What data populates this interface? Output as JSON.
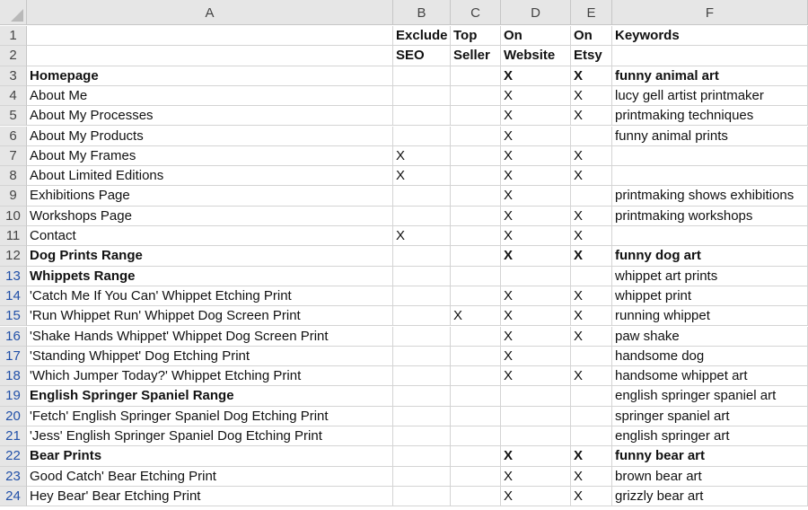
{
  "columns": [
    "A",
    "B",
    "C",
    "D",
    "E",
    "F"
  ],
  "rows": [
    {
      "num": "1",
      "blue": false,
      "bold": false,
      "cells": [
        "",
        "Exclude",
        "Top",
        "On",
        "On",
        "Keywords"
      ],
      "boldCols": [
        1,
        2,
        3,
        4,
        5
      ]
    },
    {
      "num": "2",
      "blue": false,
      "bold": false,
      "cells": [
        "",
        "SEO",
        "Seller",
        "Website",
        "Etsy",
        ""
      ],
      "boldCols": [
        1,
        2,
        3,
        4,
        5
      ]
    },
    {
      "num": "3",
      "blue": false,
      "bold": true,
      "cells": [
        "Homepage",
        "",
        "",
        "X",
        "X",
        "funny animal art"
      ]
    },
    {
      "num": "4",
      "blue": false,
      "bold": false,
      "cells": [
        "About Me",
        "",
        "",
        "X",
        "X",
        "lucy gell artist printmaker"
      ]
    },
    {
      "num": "5",
      "blue": false,
      "bold": false,
      "cells": [
        "About My Processes",
        "",
        "",
        "X",
        "X",
        "printmaking techniques"
      ]
    },
    {
      "num": "6",
      "blue": false,
      "bold": false,
      "cells": [
        "About My Products",
        "",
        "",
        "X",
        "",
        "funny animal prints"
      ]
    },
    {
      "num": "7",
      "blue": false,
      "bold": false,
      "cells": [
        "About My Frames",
        "X",
        "",
        "X",
        "X",
        ""
      ]
    },
    {
      "num": "8",
      "blue": false,
      "bold": false,
      "cells": [
        "About Limited Editions",
        "X",
        "",
        "X",
        "X",
        ""
      ]
    },
    {
      "num": "9",
      "blue": false,
      "bold": false,
      "cells": [
        "Exhibitions Page",
        "",
        "",
        "X",
        "",
        "printmaking shows exhibitions"
      ]
    },
    {
      "num": "10",
      "blue": false,
      "bold": false,
      "cells": [
        "Workshops Page",
        "",
        "",
        "X",
        "X",
        "printmaking workshops"
      ]
    },
    {
      "num": "11",
      "blue": false,
      "bold": false,
      "cells": [
        "Contact",
        "X",
        "",
        "X",
        "X",
        ""
      ]
    },
    {
      "num": "12",
      "blue": false,
      "bold": true,
      "cells": [
        "Dog Prints Range",
        "",
        "",
        "X",
        "X",
        "funny dog art"
      ]
    },
    {
      "num": "13",
      "blue": true,
      "bold": true,
      "cells": [
        "Whippets Range",
        "",
        "",
        "",
        "",
        "whippet art prints"
      ],
      "boldCols": [
        0
      ]
    },
    {
      "num": "14",
      "blue": true,
      "bold": false,
      "cells": [
        "'Catch Me If You Can' Whippet Etching Print",
        "",
        "",
        "X",
        "X",
        "whippet print"
      ]
    },
    {
      "num": "15",
      "blue": true,
      "bold": false,
      "cells": [
        "'Run Whippet Run' Whippet Dog Screen Print",
        "",
        "X",
        "X",
        "X",
        "running whippet"
      ]
    },
    {
      "num": "16",
      "blue": true,
      "bold": false,
      "cells": [
        "'Shake Hands Whippet' Whippet Dog Screen Print",
        "",
        "",
        "X",
        "X",
        "paw shake"
      ]
    },
    {
      "num": "17",
      "blue": true,
      "bold": false,
      "cells": [
        "'Standing Whippet' Dog Etching Print",
        "",
        "",
        "X",
        "",
        "handsome dog"
      ]
    },
    {
      "num": "18",
      "blue": true,
      "bold": false,
      "cells": [
        "'Which Jumper Today?' Whippet Etching Print",
        "",
        "",
        "X",
        "X",
        "handsome whippet art"
      ]
    },
    {
      "num": "19",
      "blue": true,
      "bold": true,
      "cells": [
        "English Springer Spaniel Range",
        "",
        "",
        "",
        "",
        "english springer spaniel art"
      ],
      "boldCols": [
        0
      ]
    },
    {
      "num": "20",
      "blue": true,
      "bold": false,
      "cells": [
        "'Fetch' English Springer Spaniel Dog Etching Print",
        "",
        "",
        "",
        "",
        "springer spaniel art"
      ]
    },
    {
      "num": "21",
      "blue": true,
      "bold": false,
      "cells": [
        "'Jess' English Springer Spaniel Dog Etching Print",
        "",
        "",
        "",
        "",
        "english springer art"
      ]
    },
    {
      "num": "22",
      "blue": true,
      "bold": true,
      "cells": [
        "Bear Prints",
        "",
        "",
        "X",
        "X",
        "funny bear art"
      ]
    },
    {
      "num": "23",
      "blue": true,
      "bold": false,
      "cells": [
        "Good Catch' Bear Etching Print",
        "",
        "",
        "X",
        "X",
        "brown bear art"
      ]
    },
    {
      "num": "24",
      "blue": true,
      "bold": false,
      "cells": [
        "Hey Bear' Bear Etching Print",
        "",
        "",
        "X",
        "X",
        "grizzly bear art"
      ]
    }
  ]
}
